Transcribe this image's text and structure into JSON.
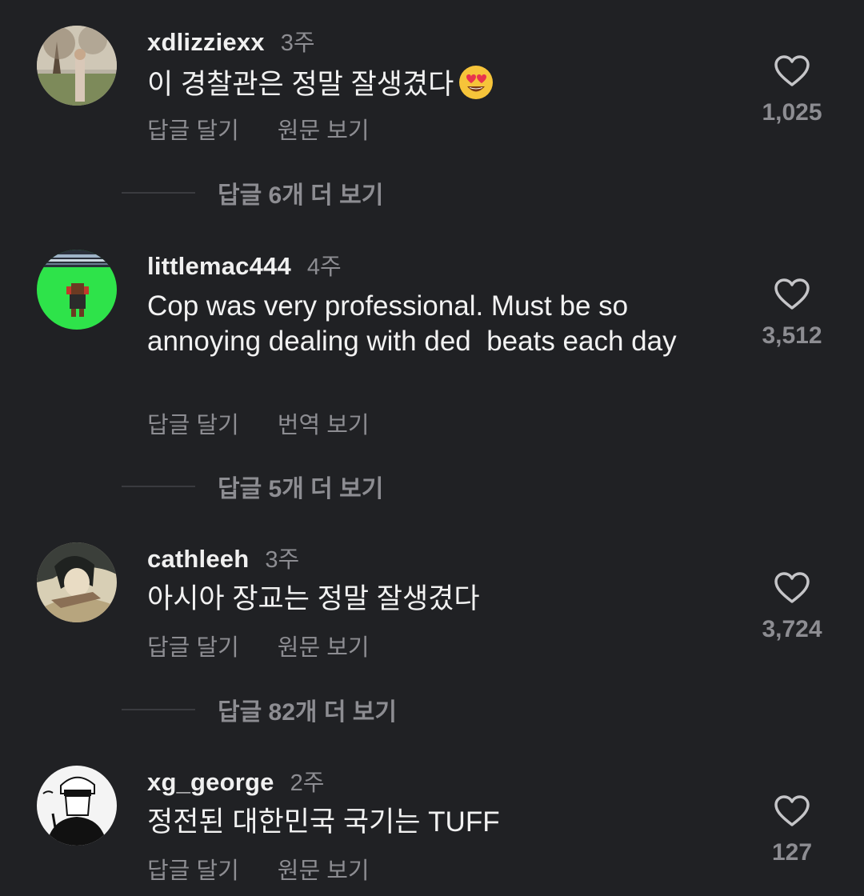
{
  "comments": [
    {
      "username": "xdlizziexx",
      "time": "3주",
      "text": "이 경찰관은 정말 잘생겼다",
      "emoji": "heart-eyes-emoji",
      "reply_label": "답글 달기",
      "translate_label": "원문 보기",
      "likes": "1,025",
      "more_replies": "답글 6개 더 보기"
    },
    {
      "username": "littlemac444",
      "time": "4주",
      "text": "Cop was very professional. Must be so annoying dealing with ded  beats each day",
      "reply_label": "답글 달기",
      "translate_label": "번역 보기",
      "likes": "3,512",
      "more_replies": "답글 5개 더 보기"
    },
    {
      "username": "cathleeh",
      "time": "3주",
      "text": "아시아 장교는 정말 잘생겼다",
      "reply_label": "답글 달기",
      "translate_label": "원문 보기",
      "likes": "3,724",
      "more_replies": "답글 82개 더 보기"
    },
    {
      "username": "xg_george",
      "time": "2주",
      "text": "정전된 대한민국 국기는 TUFF",
      "reply_label": "답글 달기",
      "translate_label": "원문 보기",
      "likes": "127"
    }
  ],
  "icons": {
    "like": "heart-outline-icon"
  },
  "colors": {
    "background": "#202124",
    "primary_text": "#f2f2f2",
    "secondary_text": "#8d8d92"
  }
}
